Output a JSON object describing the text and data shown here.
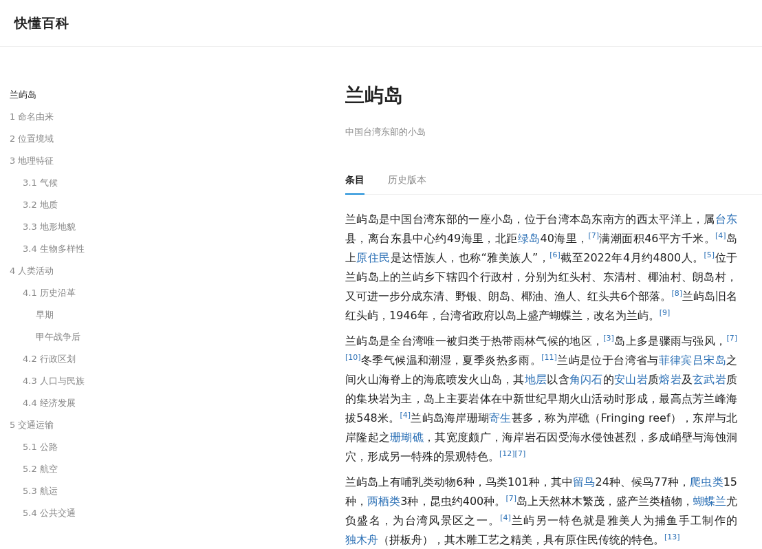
{
  "site": {
    "logo": "快懂百科"
  },
  "toc": {
    "title": "兰屿岛",
    "items": [
      {
        "label": "1 命名由来"
      },
      {
        "label": "2 位置境域"
      },
      {
        "label": "3 地理特征",
        "children": [
          {
            "label": "3.1 气候"
          },
          {
            "label": "3.2 地质"
          },
          {
            "label": "3.3 地形地貌"
          },
          {
            "label": "3.4 生物多样性"
          }
        ]
      },
      {
        "label": "4 人类活动",
        "children": [
          {
            "label": "4.1 历史沿革",
            "children": [
              {
                "label": "早期"
              },
              {
                "label": "甲午战争后"
              }
            ]
          },
          {
            "label": "4.2 行政区划"
          },
          {
            "label": "4.3 人口与民族"
          },
          {
            "label": "4.4 经济发展"
          }
        ]
      },
      {
        "label": "5 交通运输",
        "children": [
          {
            "label": "5.1 公路"
          },
          {
            "label": "5.2 航空"
          },
          {
            "label": "5.3 航运"
          },
          {
            "label": "5.4 公共交通"
          }
        ]
      }
    ]
  },
  "article": {
    "title": "兰屿岛",
    "subtitle": "中国台湾东部的小岛",
    "tabs": [
      {
        "label": "条目",
        "selected": true
      },
      {
        "label": "历史版本",
        "selected": false
      }
    ],
    "paragraphs": [
      [
        {
          "kind": "text",
          "text": "兰屿岛是中国台湾东部的一座小岛，位于台湾本岛东南方的西太平洋上，属"
        },
        {
          "kind": "link",
          "text": "台东"
        },
        {
          "kind": "text",
          "text": "县，离台东县中心约49海里，北距"
        },
        {
          "kind": "link",
          "text": "绿岛"
        },
        {
          "kind": "text",
          "text": "40海里，"
        },
        {
          "kind": "ref",
          "text": "[7]"
        },
        {
          "kind": "text",
          "text": "满潮面积46平方千米。"
        },
        {
          "kind": "ref",
          "text": "[4]"
        },
        {
          "kind": "text",
          "text": "岛上"
        },
        {
          "kind": "link",
          "text": "原住民"
        },
        {
          "kind": "text",
          "text": "是达悟族人，也称“雅美族人”，"
        },
        {
          "kind": "ref",
          "text": "[6]"
        },
        {
          "kind": "text",
          "text": "截至2022年4月约4800人。"
        },
        {
          "kind": "ref",
          "text": "[5]"
        },
        {
          "kind": "text",
          "text": "位于兰屿岛上的兰屿乡下辖四个行政村，分别为红头村、东清村、椰油村、朗岛村，又可进一步分成东清、野银、朗岛、椰油、渔人、红头共6个部落。"
        },
        {
          "kind": "ref",
          "text": "[8]"
        },
        {
          "kind": "text",
          "text": "兰屿岛旧名红头屿，1946年，台湾省政府以岛上盛产蝴蝶兰，改名为兰屿。"
        },
        {
          "kind": "ref",
          "text": "[9]"
        }
      ],
      [
        {
          "kind": "text",
          "text": "兰屿岛是全台湾唯一被归类于热带雨林气候的地区，"
        },
        {
          "kind": "ref",
          "text": "[3]"
        },
        {
          "kind": "text",
          "text": "岛上多是骤雨与强风，"
        },
        {
          "kind": "ref",
          "text": "[7]"
        },
        {
          "kind": "ref",
          "text": "[10]"
        },
        {
          "kind": "text",
          "text": "冬季气候温和潮湿，夏季炎热多雨。"
        },
        {
          "kind": "ref",
          "text": "[11]"
        },
        {
          "kind": "text",
          "text": "兰屿是位于台湾省与"
        },
        {
          "kind": "link",
          "text": "菲律宾吕宋岛"
        },
        {
          "kind": "text",
          "text": "之间火山海脊上的海底喷发火山岛，其"
        },
        {
          "kind": "link",
          "text": "地层"
        },
        {
          "kind": "text",
          "text": "以含"
        },
        {
          "kind": "link",
          "text": "角闪石"
        },
        {
          "kind": "text",
          "text": "的"
        },
        {
          "kind": "link",
          "text": "安山岩"
        },
        {
          "kind": "text",
          "text": "质"
        },
        {
          "kind": "link",
          "text": "熔岩"
        },
        {
          "kind": "text",
          "text": "及"
        },
        {
          "kind": "link",
          "text": "玄武岩"
        },
        {
          "kind": "text",
          "text": "质的集块岩为主，岛上主要岩体在中新世纪早期火山活动时形成，最高点芳兰峰海拔548米。"
        },
        {
          "kind": "ref",
          "text": "[4]"
        },
        {
          "kind": "text",
          "text": "兰屿岛海岸珊瑚"
        },
        {
          "kind": "link",
          "text": "寄生"
        },
        {
          "kind": "text",
          "text": "甚多，称为岸礁（Fringing reef），东岸与北岸隆起之"
        },
        {
          "kind": "link",
          "text": "珊瑚礁"
        },
        {
          "kind": "text",
          "text": "，其宽度颇广，海岸岩石因受海水侵蚀甚烈，多成峭壁与海蚀洞穴，形成另一特殊的景观特色。"
        },
        {
          "kind": "ref",
          "text": "[12]"
        },
        {
          "kind": "ref",
          "text": "[7]"
        }
      ],
      [
        {
          "kind": "text",
          "text": "兰屿岛上有哺乳类动物6种，鸟类101种，其中"
        },
        {
          "kind": "link",
          "text": "留鸟"
        },
        {
          "kind": "text",
          "text": "24种、候鸟77种，"
        },
        {
          "kind": "link",
          "text": "爬虫类"
        },
        {
          "kind": "text",
          "text": "15种，"
        },
        {
          "kind": "link",
          "text": "两栖类"
        },
        {
          "kind": "text",
          "text": "3种，昆虫约400种。"
        },
        {
          "kind": "ref",
          "text": "[7]"
        },
        {
          "kind": "text",
          "text": "岛上天然林木繁茂，盛产兰类植物，"
        },
        {
          "kind": "link",
          "text": "蝴蝶兰"
        },
        {
          "kind": "text",
          "text": "尤负盛名，为台湾风景区之一。"
        },
        {
          "kind": "ref",
          "text": "[4]"
        },
        {
          "kind": "text",
          "text": "兰屿另一特色就是雅美人为捕鱼手工制作的"
        },
        {
          "kind": "link",
          "text": "独木舟"
        },
        {
          "kind": "text",
          "text": "（拼板舟），其木雕工艺之精美，具有原住民传统的特色。"
        },
        {
          "kind": "ref",
          "text": "[13]"
        }
      ]
    ]
  }
}
